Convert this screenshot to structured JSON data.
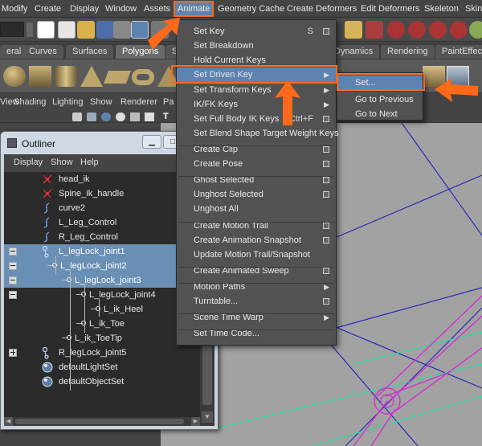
{
  "menubar": {
    "items": [
      "Modify",
      "Create",
      "Display",
      "Window",
      "Assets",
      "Animate",
      "Geometry Cache",
      "Create Deformers",
      "Edit Deformers",
      "Skeleton",
      "Skin"
    ]
  },
  "shelf_tabs": [
    "eral",
    "Curves",
    "Surfaces",
    "Polygons",
    "S",
    "Dynamics",
    "Rendering",
    "PaintEffects"
  ],
  "panel_menu": [
    "View",
    "Shading",
    "Lighting",
    "Show",
    "Renderer",
    "Pa"
  ],
  "panel_tools_label": "T",
  "outliner": {
    "title": "Outliner",
    "menu": [
      "Display",
      "Show",
      "Help"
    ],
    "rows": [
      {
        "label": "head_ik",
        "icon": "ik-handle-icon",
        "indent": 0,
        "selected": false,
        "expander": ""
      },
      {
        "label": "Spine_ik_handle",
        "icon": "ik-handle-icon",
        "indent": 0,
        "selected": false,
        "expander": ""
      },
      {
        "label": "curve2",
        "icon": "curve-icon",
        "indent": 0,
        "selected": false,
        "expander": ""
      },
      {
        "label": "L_Leg_Control",
        "icon": "curve-icon",
        "indent": 0,
        "selected": false,
        "expander": ""
      },
      {
        "label": "R_Leg_Control",
        "icon": "curve-icon",
        "indent": 0,
        "selected": false,
        "expander": ""
      },
      {
        "label": "L_legLock_joint1",
        "icon": "joint-icon",
        "indent": 0,
        "selected": true,
        "expander": "minus"
      },
      {
        "label": "L_legLock_joint2",
        "icon": "",
        "indent": 1,
        "selected": true,
        "expander": "minus"
      },
      {
        "label": "L_legLock_joint3",
        "icon": "",
        "indent": 2,
        "selected": true,
        "expander": "minus"
      },
      {
        "label": "L_legLock_joint4",
        "icon": "joint-icon",
        "indent": 3,
        "selected": false,
        "expander": "minus"
      },
      {
        "label": "L_ik_Heel",
        "icon": "ik-handle-icon",
        "indent": 4,
        "selected": false,
        "expander": ""
      },
      {
        "label": "L_ik_Toe",
        "icon": "joint-icon",
        "indent": 3,
        "selected": false,
        "expander": ""
      },
      {
        "label": "L_ik_ToeTip",
        "icon": "ik-handle-icon",
        "indent": 2,
        "selected": false,
        "expander": ""
      },
      {
        "label": "R_legLock_joint5",
        "icon": "joint-icon",
        "indent": 0,
        "selected": false,
        "expander": "plus"
      },
      {
        "label": "defaultLightSet",
        "icon": "set-icon",
        "indent": 0,
        "selected": false,
        "expander": ""
      },
      {
        "label": "defaultObjectSet",
        "icon": "set-icon",
        "indent": 0,
        "selected": false,
        "expander": ""
      }
    ]
  },
  "animate_menu": {
    "items": [
      {
        "label": "Set Key",
        "shortcut": "S",
        "option": true,
        "submenu": false
      },
      {
        "label": "Set Breakdown",
        "shortcut": "",
        "option": false,
        "submenu": false
      },
      {
        "label": "Hold Current Keys",
        "shortcut": "",
        "option": false,
        "submenu": false
      },
      {
        "label": "Set Driven Key",
        "shortcut": "",
        "option": false,
        "submenu": true,
        "highlight": true
      },
      {
        "label": "Set Transform Keys",
        "shortcut": "",
        "option": false,
        "submenu": true
      },
      {
        "label": "IK/FK Keys",
        "shortcut": "",
        "option": false,
        "submenu": true
      },
      {
        "label": "Set Full Body IK Keys",
        "shortcut": "Ctrl+F",
        "option": true,
        "submenu": false
      },
      {
        "label": "Set Blend Shape Target Weight Keys",
        "shortcut": "",
        "option": false,
        "submenu": false
      },
      {
        "label": "Create Clip",
        "shortcut": "",
        "option": true,
        "submenu": false
      },
      {
        "label": "Create Pose",
        "shortcut": "",
        "option": true,
        "submenu": false
      },
      {
        "label": "Ghost Selected",
        "shortcut": "",
        "option": true,
        "submenu": false
      },
      {
        "label": "Unghost Selected",
        "shortcut": "",
        "option": true,
        "submenu": false
      },
      {
        "label": "Unghost All",
        "shortcut": "",
        "option": false,
        "submenu": false
      },
      {
        "label": "Create Motion Trail",
        "shortcut": "",
        "option": true,
        "submenu": false
      },
      {
        "label": "Create Animation Snapshot",
        "shortcut": "",
        "option": true,
        "submenu": false
      },
      {
        "label": "Update Motion Trail/Snapshot",
        "shortcut": "",
        "option": false,
        "submenu": false
      },
      {
        "label": "Create Animated Sweep",
        "shortcut": "",
        "option": true,
        "submenu": false
      },
      {
        "label": "Motion Paths",
        "shortcut": "",
        "option": false,
        "submenu": true
      },
      {
        "label": "Turntable...",
        "shortcut": "",
        "option": true,
        "submenu": false
      },
      {
        "label": "Scene Time Warp",
        "shortcut": "",
        "option": false,
        "submenu": true
      },
      {
        "label": "Set Time Code...",
        "shortcut": "",
        "option": false,
        "submenu": false
      }
    ]
  },
  "driven_key_submenu": {
    "items": [
      "Set...",
      "Go to Previous",
      "Go to Next"
    ]
  },
  "colors": {
    "highlight": "#5d84b0",
    "annotation": "#ff6a1a",
    "selection": "#6a8fb5"
  }
}
